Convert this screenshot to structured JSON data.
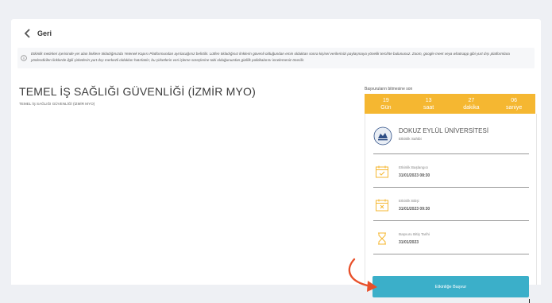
{
  "nav": {
    "back_label": "Geri"
  },
  "notice": {
    "text": "Etkinlik metinleri içerisinde yer alan linklere tıkladığınızda Yetenek Kapısı Platformundan ayrılacağınız belirtilir. Lütfen tıkladığınız linklerin güvenli olduğundan emin olduktan sonra kişisel verilerinizi paylaşmaya yönelik tercihte bulununuz. Zoom, google meet veya whatsapp gibi yurt dışı platformlara yönlendirilen linklerde ilgili şirketlerin yurt dışı merkezli oldukları hatırlatılır, bu şirketlerin veri işleme süreçlerine tabi olduğunuzdan gizlilik politikalarını incelemeniz önerilir."
  },
  "event": {
    "title": "TEMEL İŞ SAĞLIĞI GÜVENLİĞİ (İZMİR MYO)",
    "subtitle": "TEMEL İŞ SAĞLIĞI GÜVENLİĞİ (İZMİR MYO)"
  },
  "countdown": {
    "label": "Başvuruların bitmesine son",
    "cells": [
      {
        "num": "19",
        "unit": "Gün"
      },
      {
        "num": "13",
        "unit": "saat"
      },
      {
        "num": "27",
        "unit": "dakika"
      },
      {
        "num": "06",
        "unit": "saniye"
      }
    ]
  },
  "organizer": {
    "name": "DOKUZ EYLÜL ÜNİVERSİTESİ",
    "role": "Etkinlik Sahibi"
  },
  "details": [
    {
      "label": "Etkinlik Başlangıcı",
      "value": "31/01/2023 08:30",
      "icon": "calendar-check-icon"
    },
    {
      "label": "Etkinlik Bitişi",
      "value": "31/01/2023 09:30",
      "icon": "calendar-x-icon"
    },
    {
      "label": "Başvuru Bitiş Tarihi",
      "value": "31/01/2023",
      "icon": "hourglass-icon"
    }
  ],
  "apply": {
    "label": "Etkinliğe Başvur"
  },
  "colors": {
    "accent": "#f5b731",
    "button": "#3bafc9",
    "arrow": "#e8502a",
    "icon": "#f5b731"
  }
}
